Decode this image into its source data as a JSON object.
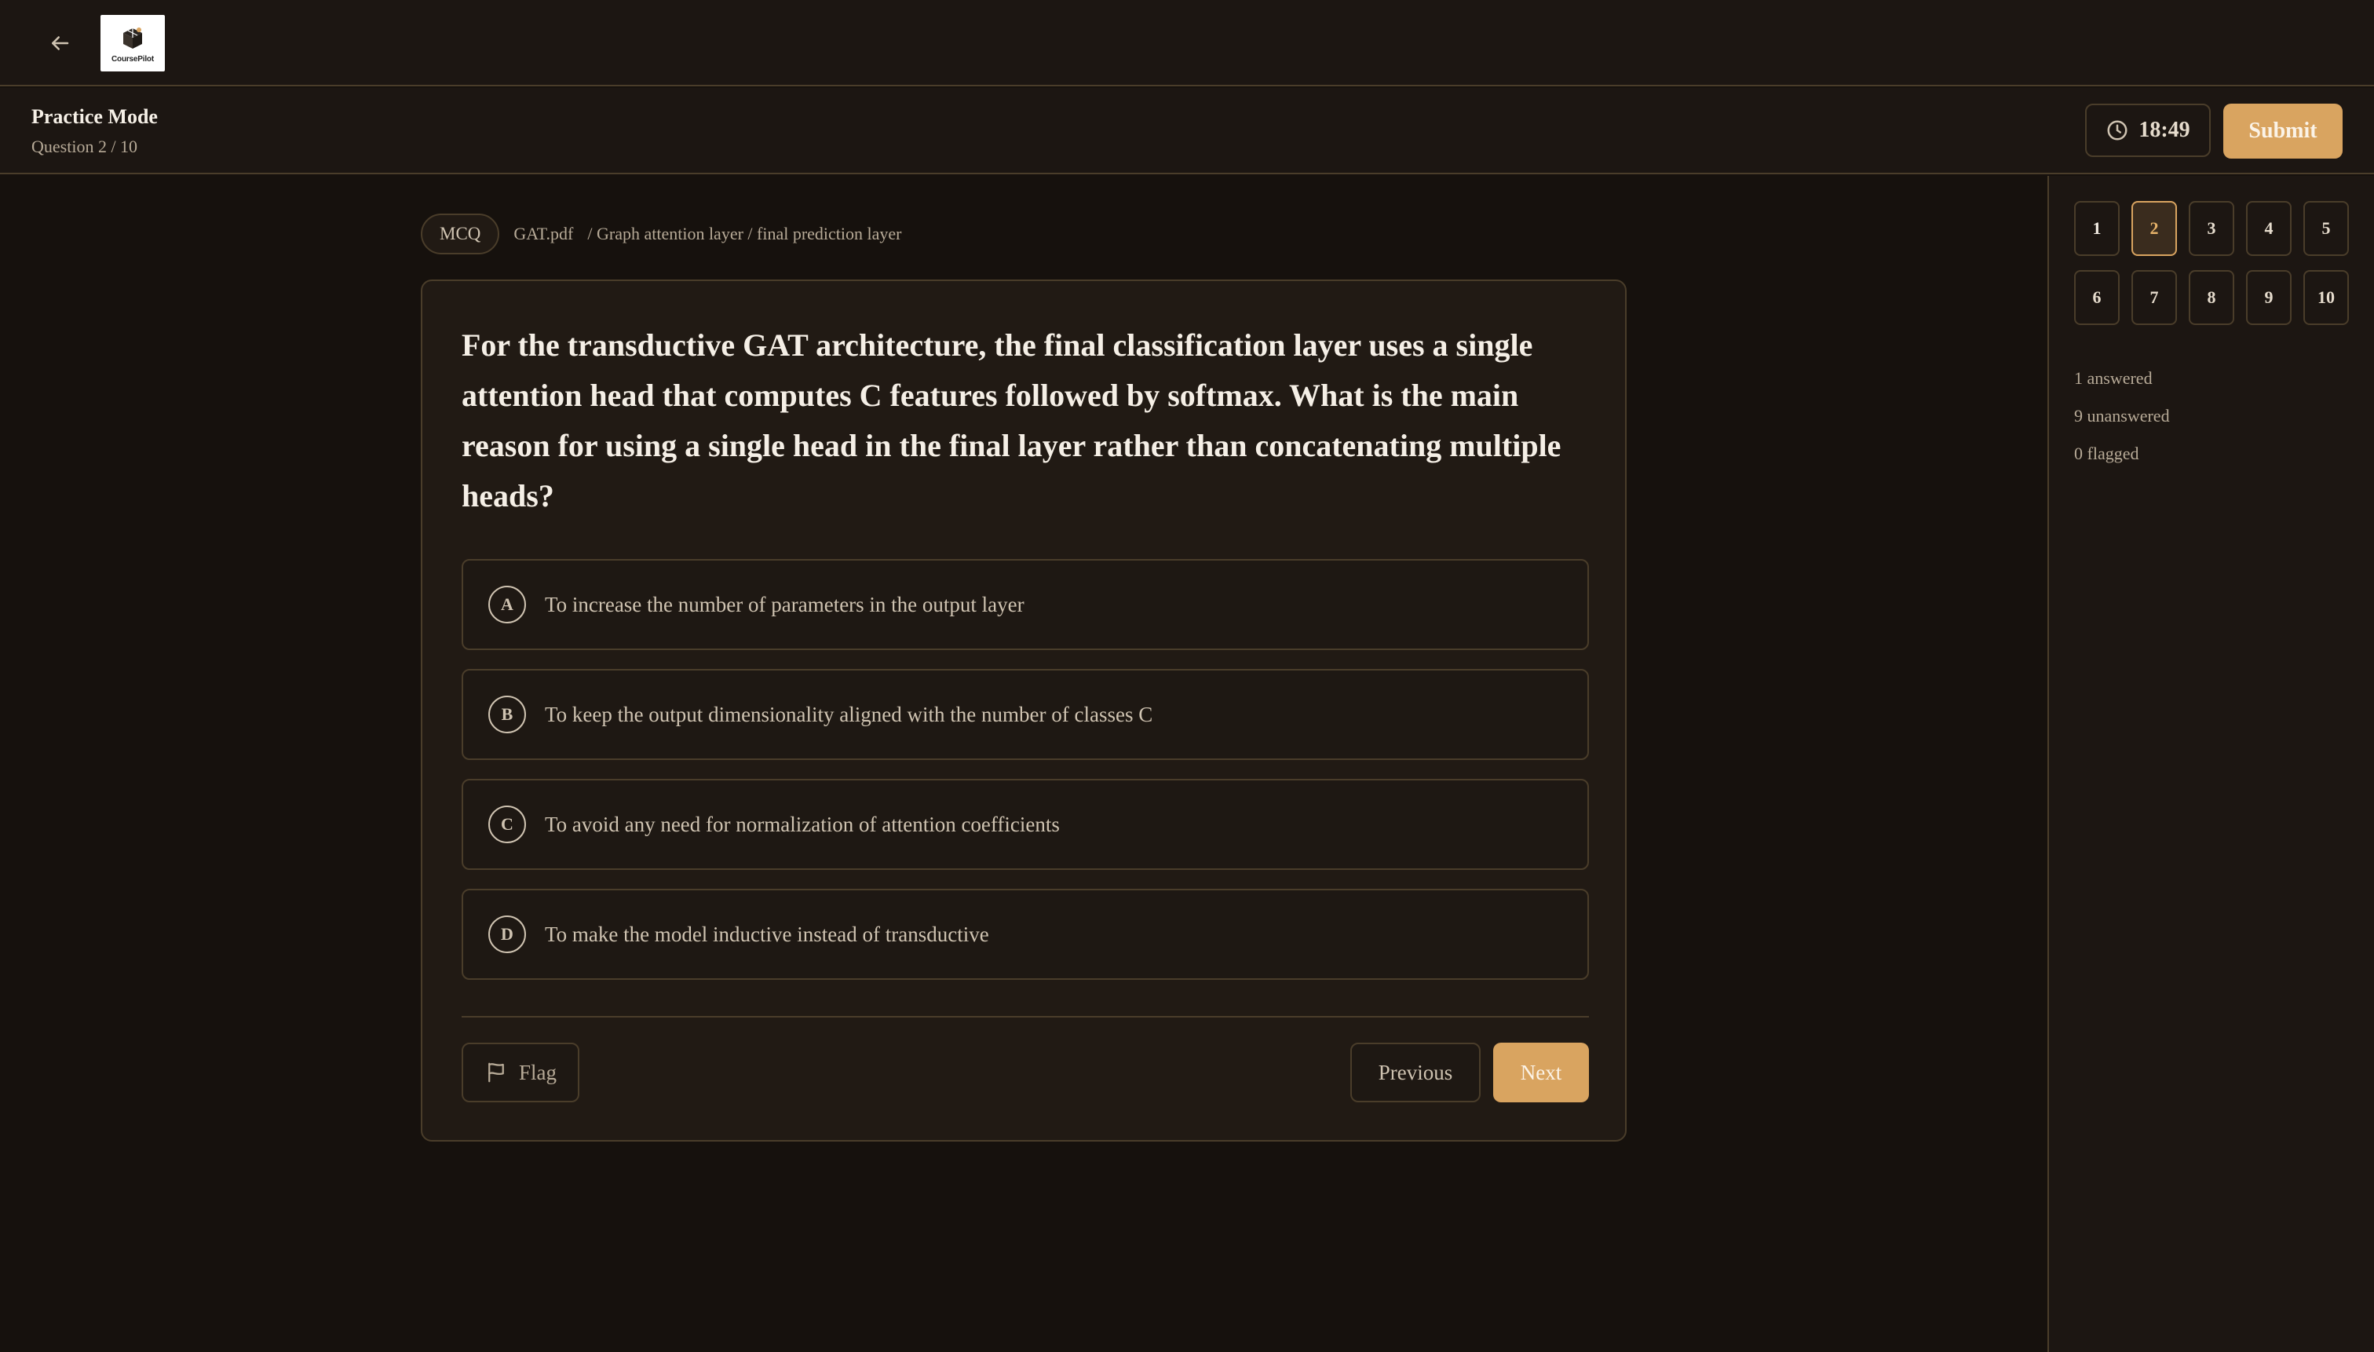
{
  "header": {
    "back_icon": "arrow-left-icon",
    "logo_text": "CoursePilot"
  },
  "subheader": {
    "mode_title": "Practice Mode",
    "question_progress": "Question 2 / 10",
    "timer": "18:49",
    "timer_icon": "clock-icon",
    "submit_label": "Submit"
  },
  "breadcrumb": {
    "type_badge": "MCQ",
    "source": "GAT.pdf",
    "path": "/ Graph attention layer / final prediction layer"
  },
  "question": {
    "text": "For the transductive GAT architecture, the final classification layer uses a single attention head that computes C features followed by softmax. What is the main reason for using a single head in the final layer rather than concatenating multiple heads?",
    "options": [
      {
        "letter": "A",
        "text": "To increase the number of parameters in the output layer"
      },
      {
        "letter": "B",
        "text": "To keep the output dimensionality aligned with the number of classes C"
      },
      {
        "letter": "C",
        "text": "To avoid any need for normalization of attention coefficients"
      },
      {
        "letter": "D",
        "text": "To make the model inductive instead of transductive"
      }
    ]
  },
  "footer": {
    "flag_label": "Flag",
    "flag_icon": "flag-icon",
    "previous_label": "Previous",
    "next_label": "Next"
  },
  "navigator": {
    "questions": [
      "1",
      "2",
      "3",
      "4",
      "5",
      "6",
      "7",
      "8",
      "9",
      "10"
    ],
    "current": "2",
    "answered_label": "1 answered",
    "unanswered_label": "9 unanswered",
    "flagged_label": "0 flagged"
  },
  "colors": {
    "accent": "#d9a460",
    "background": "#16110d",
    "panel": "#1c1612",
    "border": "#4a3d2a"
  }
}
